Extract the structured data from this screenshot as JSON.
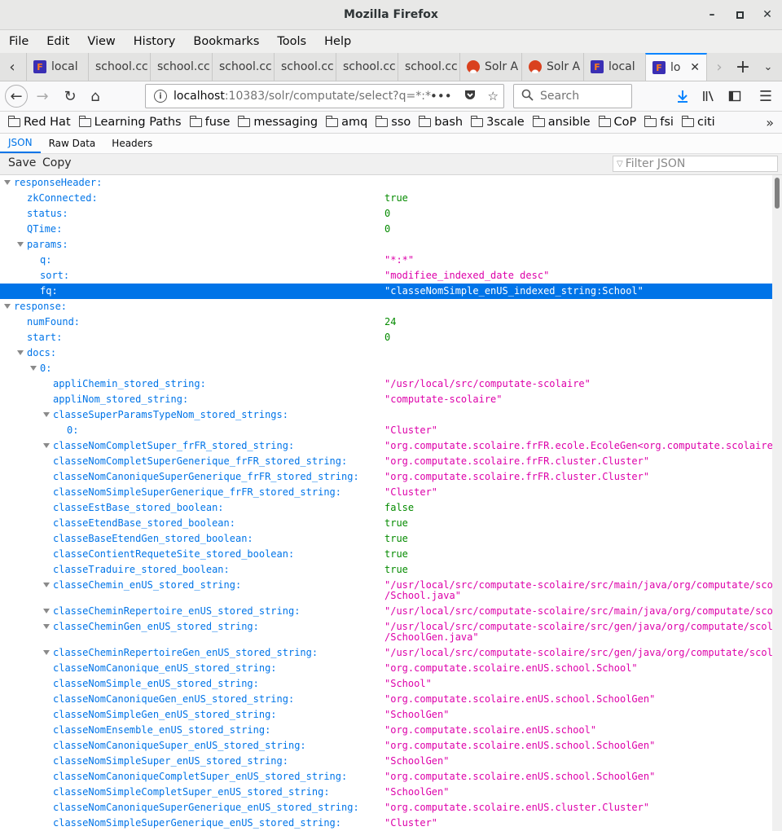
{
  "window": {
    "title": "Mozilla Firefox"
  },
  "menu": [
    "File",
    "Edit",
    "View",
    "History",
    "Bookmarks",
    "Tools",
    "Help"
  ],
  "tabs": [
    {
      "label": "local",
      "icon": "firefox-icon"
    },
    {
      "label": "school.cc",
      "icon": ""
    },
    {
      "label": "school.cc",
      "icon": ""
    },
    {
      "label": "school.cc",
      "icon": ""
    },
    {
      "label": "school.cc",
      "icon": ""
    },
    {
      "label": "school.cc",
      "icon": ""
    },
    {
      "label": "school.cc",
      "icon": ""
    },
    {
      "label": "Solr A",
      "icon": "solr-icon"
    },
    {
      "label": "Solr A",
      "icon": "solr-icon"
    },
    {
      "label": "local",
      "icon": "firefox-icon"
    },
    {
      "label": "lo",
      "icon": "firefox-icon",
      "active": true
    }
  ],
  "nav": {
    "url_host": "localhost",
    "url_rest": ":10383/solr/computate/select?q=*:*",
    "search_placeholder": "Search"
  },
  "bookmarks": [
    "Red Hat",
    "Learning Paths",
    "fuse",
    "messaging",
    "amq",
    "sso",
    "bash",
    "3scale",
    "ansible",
    "CoP",
    "fsi",
    "citi"
  ],
  "viewer": {
    "tabs": [
      "JSON",
      "Raw Data",
      "Headers"
    ],
    "save_label": "Save",
    "copy_label": "Copy",
    "filter_placeholder": "Filter JSON"
  },
  "tree": [
    {
      "k": "responseHeader:",
      "v": "",
      "t": "",
      "d": 0,
      "tw": true
    },
    {
      "k": "zkConnected:",
      "v": "true",
      "t": "bool",
      "d": 1
    },
    {
      "k": "status:",
      "v": "0",
      "t": "num",
      "d": 1
    },
    {
      "k": "QTime:",
      "v": "0",
      "t": "num",
      "d": 1
    },
    {
      "k": "params:",
      "v": "",
      "t": "",
      "d": 1,
      "tw": true
    },
    {
      "k": "q:",
      "v": "\"*:*\"",
      "t": "str",
      "d": 2
    },
    {
      "k": "sort:",
      "v": "\"modifiee_indexed_date desc\"",
      "t": "str",
      "d": 2
    },
    {
      "k": "fq:",
      "v": "\"classeNomSimple_enUS_indexed_string:School\"",
      "t": "str",
      "d": 2,
      "sel": true
    },
    {
      "k": "response:",
      "v": "",
      "t": "",
      "d": 0,
      "tw": true
    },
    {
      "k": "numFound:",
      "v": "24",
      "t": "num",
      "d": 1
    },
    {
      "k": "start:",
      "v": "0",
      "t": "num",
      "d": 1
    },
    {
      "k": "docs:",
      "v": "",
      "t": "",
      "d": 1,
      "tw": true
    },
    {
      "k": "0:",
      "v": "",
      "t": "",
      "d": 2,
      "tw": true
    },
    {
      "k": "appliChemin_stored_string:",
      "v": "\"/usr/local/src/computate-scolaire\"",
      "t": "str",
      "d": 3
    },
    {
      "k": "appliNom_stored_string:",
      "v": "\"computate-scolaire\"",
      "t": "str",
      "d": 3
    },
    {
      "k": "classeSuperParamsTypeNom_stored_strings:",
      "v": "",
      "t": "",
      "d": 3,
      "tw": true
    },
    {
      "k": "0:",
      "v": "\"Cluster\"",
      "t": "str",
      "d": 4
    },
    {
      "k": "classeNomCompletSuper_frFR_stored_string:",
      "v": "\"org.computate.scolaire.frFR.ecole.EcoleGen<org.computate.scolaire.frFR.",
      "t": "str",
      "d": 3,
      "tw": true
    },
    {
      "k": "classeNomCompletSuperGenerique_frFR_stored_string:",
      "v": "\"org.computate.scolaire.frFR.cluster.Cluster\"",
      "t": "str",
      "d": 3
    },
    {
      "k": "classeNomCanoniqueSuperGenerique_frFR_stored_string:",
      "v": "\"org.computate.scolaire.frFR.cluster.Cluster\"",
      "t": "str",
      "d": 3
    },
    {
      "k": "classeNomSimpleSuperGenerique_frFR_stored_string:",
      "v": "\"Cluster\"",
      "t": "str",
      "d": 3
    },
    {
      "k": "classeEstBase_stored_boolean:",
      "v": "false",
      "t": "bool",
      "d": 3
    },
    {
      "k": "classeEtendBase_stored_boolean:",
      "v": "true",
      "t": "bool",
      "d": 3
    },
    {
      "k": "classeBaseEtendGen_stored_boolean:",
      "v": "true",
      "t": "bool",
      "d": 3
    },
    {
      "k": "classeContientRequeteSite_stored_boolean:",
      "v": "true",
      "t": "bool",
      "d": 3
    },
    {
      "k": "classeTraduire_stored_boolean:",
      "v": "true",
      "t": "bool",
      "d": 3
    },
    {
      "k": "classeChemin_enUS_stored_string:",
      "v": "\"/usr/local/src/computate-scolaire/src/main/java/org/computate/scolaire/",
      "v2": "/School.java\"",
      "t": "str",
      "d": 3,
      "tw": true,
      "tall": true
    },
    {
      "k": "classeCheminRepertoire_enUS_stored_string:",
      "v": "\"/usr/local/src/computate-scolaire/src/main/java/org/computate/scolaire/",
      "t": "str",
      "d": 3,
      "tw": true
    },
    {
      "k": "classeCheminGen_enUS_stored_string:",
      "v": "\"/usr/local/src/computate-scolaire/src/gen/java/org/computate/scolaire/",
      "v2": "/SchoolGen.java\"",
      "t": "str",
      "d": 3,
      "tw": true,
      "tall": true
    },
    {
      "k": "classeCheminRepertoireGen_enUS_stored_string:",
      "v": "\"/usr/local/src/computate-scolaire/src/gen/java/org/computate/scolaire/",
      "t": "str",
      "d": 3,
      "tw": true
    },
    {
      "k": "classeNomCanonique_enUS_stored_string:",
      "v": "\"org.computate.scolaire.enUS.school.School\"",
      "t": "str",
      "d": 3
    },
    {
      "k": "classeNomSimple_enUS_stored_string:",
      "v": "\"School\"",
      "t": "str",
      "d": 3
    },
    {
      "k": "classeNomCanoniqueGen_enUS_stored_string:",
      "v": "\"org.computate.scolaire.enUS.school.SchoolGen\"",
      "t": "str",
      "d": 3
    },
    {
      "k": "classeNomSimpleGen_enUS_stored_string:",
      "v": "\"SchoolGen\"",
      "t": "str",
      "d": 3
    },
    {
      "k": "classeNomEnsemble_enUS_stored_string:",
      "v": "\"org.computate.scolaire.enUS.school\"",
      "t": "str",
      "d": 3
    },
    {
      "k": "classeNomCanoniqueSuper_enUS_stored_string:",
      "v": "\"org.computate.scolaire.enUS.school.SchoolGen\"",
      "t": "str",
      "d": 3
    },
    {
      "k": "classeNomSimpleSuper_enUS_stored_string:",
      "v": "\"SchoolGen\"",
      "t": "str",
      "d": 3
    },
    {
      "k": "classeNomCanoniqueCompletSuper_enUS_stored_string:",
      "v": "\"org.computate.scolaire.enUS.school.SchoolGen\"",
      "t": "str",
      "d": 3
    },
    {
      "k": "classeNomSimpleCompletSuper_enUS_stored_string:",
      "v": "\"SchoolGen\"",
      "t": "str",
      "d": 3
    },
    {
      "k": "classeNomCanoniqueSuperGenerique_enUS_stored_string:",
      "v": "\"org.computate.scolaire.enUS.cluster.Cluster\"",
      "t": "str",
      "d": 3
    },
    {
      "k": "classeNomSimpleSuperGenerique_enUS_stored_string:",
      "v": "\"Cluster\"",
      "t": "str",
      "d": 3
    }
  ]
}
